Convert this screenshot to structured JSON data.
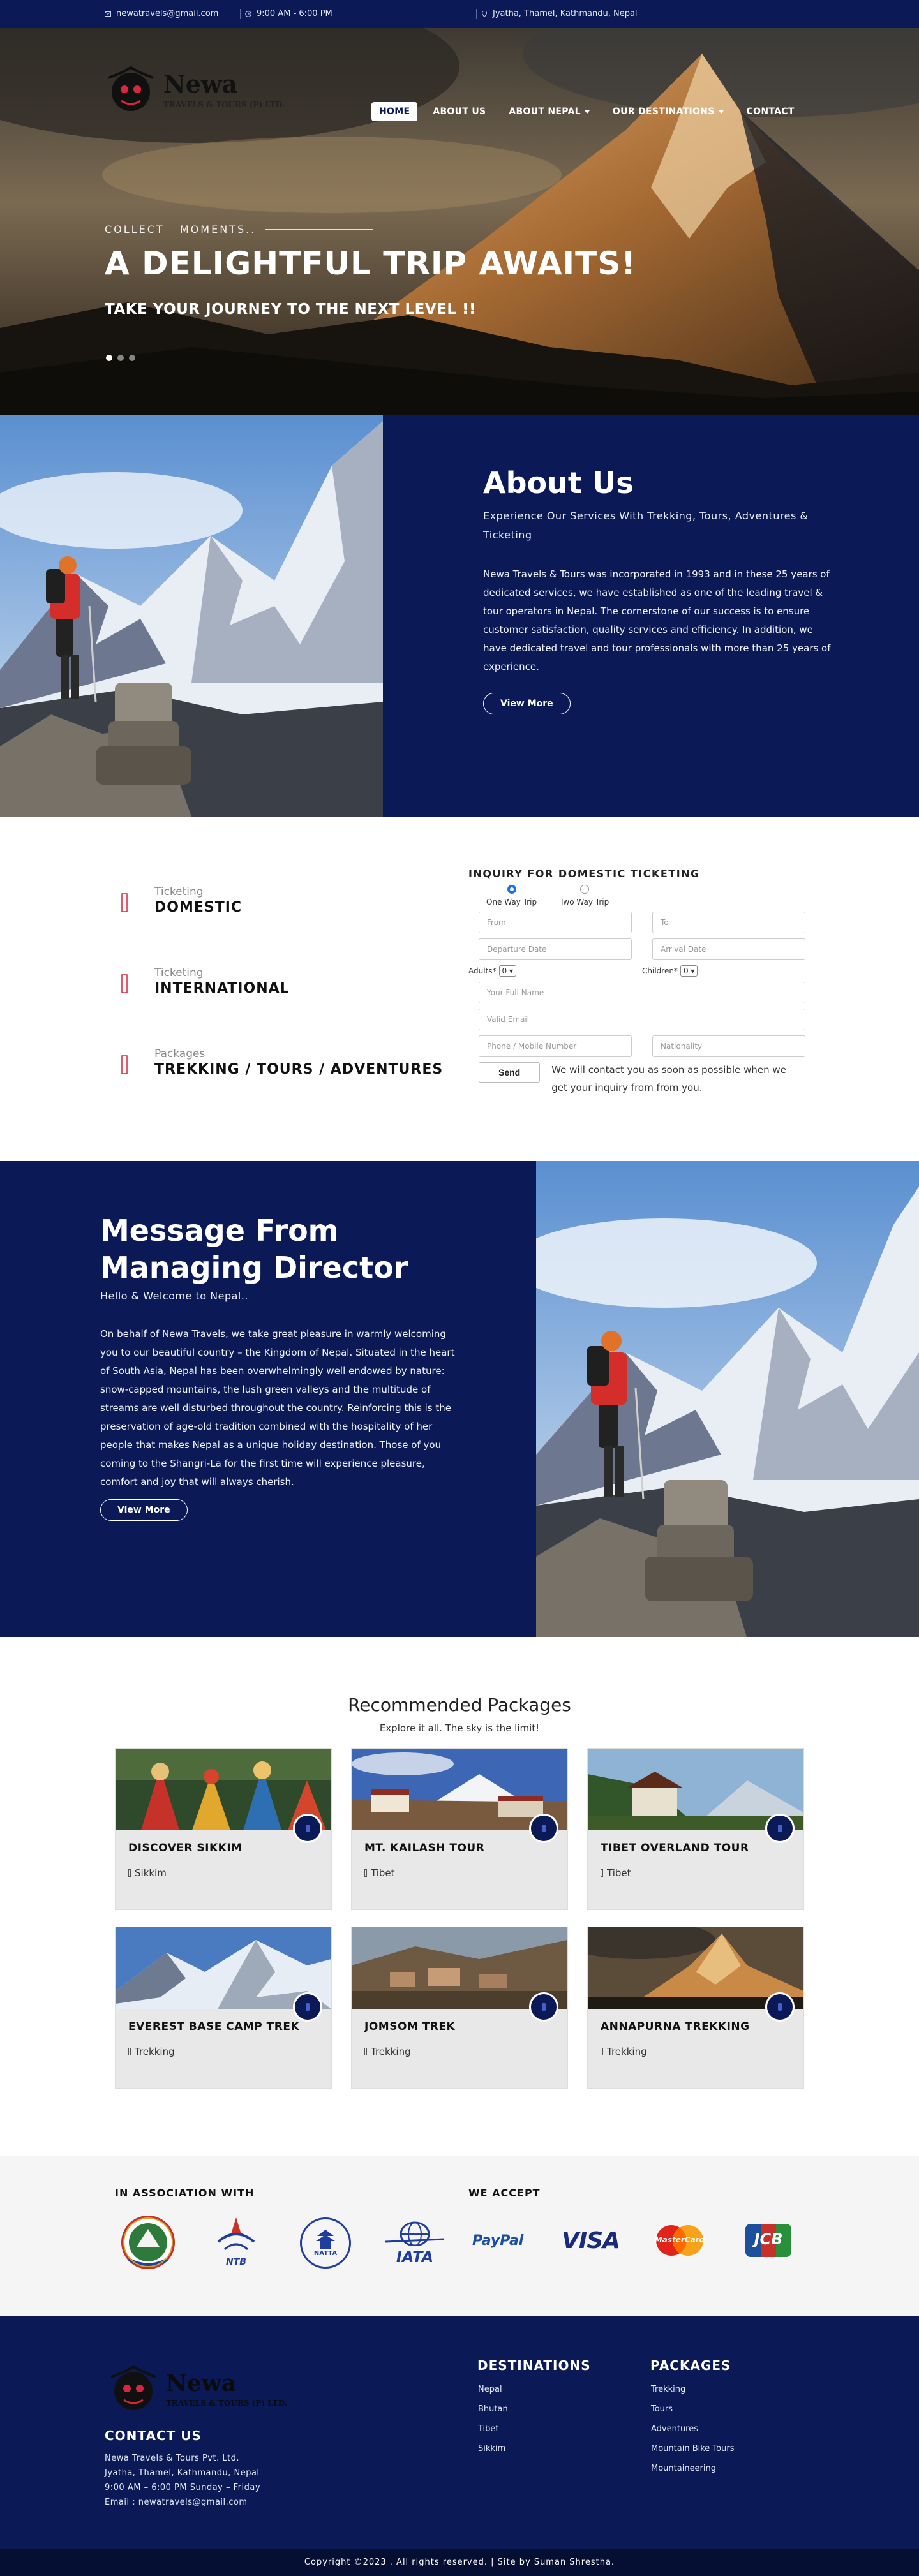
{
  "topbar": {
    "email": "newatravels@gmail.com",
    "hours": "9:00 AM - 6:00 PM",
    "address": "Jyatha, Thamel, Kathmandu, Nepal"
  },
  "brand": {
    "name": "Newa",
    "subtitle": "TRAVELS & TOURS (P) LTD."
  },
  "nav": {
    "items": [
      {
        "label": "HOME",
        "active": true
      },
      {
        "label": "ABOUT US"
      },
      {
        "label": "ABOUT NEPAL",
        "dropdown": true
      },
      {
        "label": "OUR DESTINATIONS",
        "dropdown": true
      },
      {
        "label": "CONTACT"
      }
    ]
  },
  "hero": {
    "kicker": "COLLECT   MOMENTS..",
    "headline": "A DELIGHTFUL TRIP AWAITS!",
    "subheadline": "TAKE YOUR JOURNEY TO THE NEXT LEVEL !!"
  },
  "about": {
    "title": "About Us",
    "subtitle": "Experience Our Services With Trekking, Tours, Adventures & Ticketing",
    "body": "Newa Travels & Tours was incorporated in 1993 and in these 25 years of dedicated services, we have established as one of the leading travel & tour operators in Nepal. The cornerstone of our success is to ensure customer satisfaction, quality services and efficiency. In addition, we have dedicated travel and tour professionals with more than 25 years of experience.",
    "button": "View More"
  },
  "services": [
    {
      "label": "Ticketing",
      "value": "DOMESTIC"
    },
    {
      "label": "Ticketing",
      "value": "INTERNATIONAL"
    },
    {
      "label": "Packages",
      "value": "TREKKING / TOURS / ADVENTURES"
    }
  ],
  "inquiry": {
    "title": "INQUIRY FOR DOMESTIC TICKETING",
    "one_way": "One Way Trip",
    "two_way": "Two Way Trip",
    "from_placeholder": "From",
    "to_placeholder": "To",
    "departure_placeholder": "Departure Date",
    "arrival_placeholder": "Arrival Date",
    "adults_label": "Adults*",
    "adults_value": "0",
    "children_label": "Children*",
    "children_value": "0",
    "name_placeholder": "Your Full Name",
    "email_placeholder": "Valid Email",
    "phone_placeholder": "Phone / Mobile Number",
    "nationality_placeholder": "Nationality",
    "send_label": "Send",
    "note": "We will contact you as soon as possible when we get your inquiry from from you."
  },
  "message": {
    "title": "Message From Managing Director",
    "subtitle": "Hello & Welcome to Nepal..",
    "body": "On behalf of Newa Travels, we take great pleasure in warmly welcoming you to our beautiful country – the Kingdom of Nepal. Situated in the heart of South Asia, Nepal has been overwhelmingly well endowed by nature: snow-capped mountains, the lush green valleys and the multitude of streams are well disturbed throughout the country. Reinforcing this is the preservation of age-old tradition combined with the hospitality of her people that makes Nepal as a unique holiday destination. Those of you coming to the Shangri-La for the first time will experience pleasure, comfort and joy that will always cherish.",
    "button": "View More"
  },
  "packages": {
    "title": "Recommended Packages",
    "tagline": "Explore it all. The sky is the limit!",
    "items": [
      {
        "title": "DISCOVER SIKKIM",
        "category": "Sikkim"
      },
      {
        "title": "MT. KAILASH TOUR",
        "category": "Tibet"
      },
      {
        "title": "TIBET OVERLAND TOUR",
        "category": "Tibet"
      },
      {
        "title": "EVEREST BASE CAMP TREK",
        "category": "Trekking"
      },
      {
        "title": "JOMSOM TREK",
        "category": "Trekking"
      },
      {
        "title": "ANNAPURNA TREKKING",
        "category": "Trekking"
      }
    ]
  },
  "association": {
    "title": "IN ASSOCIATION WITH",
    "logos": [
      "Nepal Government emblem",
      "NTB",
      "NATTA",
      "IATA"
    ],
    "ntb_text": "NTB",
    "natta_text": "NATTA",
    "iata_text": "IATA"
  },
  "payments": {
    "title": "WE ACCEPT",
    "paypal": "PayPal",
    "visa": "VISA",
    "mastercard": "MasterCard",
    "jcb": "JCB"
  },
  "footer": {
    "contact_title": "CONTACT US",
    "contact_lines": [
      "Newa Travels & Tours Pvt. Ltd.",
      "Jyatha, Thamel, Kathmandu, Nepal",
      "9:00 AM – 6:00 PM Sunday – Friday",
      "Email : newatravels@gmail.com"
    ],
    "destinations_title": "DESTINATIONS",
    "destinations": [
      "Nepal",
      "Bhutan",
      "Tibet",
      "Sikkim"
    ],
    "packages_title": "PACKAGES",
    "packages": [
      "Trekking",
      "Tours",
      "Adventures",
      "Mountain Bike Tours",
      "Mountaineering"
    ],
    "copyright": "Copyright ©2023 . All rights reserved. | Site by Suman Shrestha."
  },
  "colors": {
    "navy": "#0b1a56",
    "accent_red": "#d9253d",
    "white": "#ffffff"
  },
  "icons": [
    "envelope-icon",
    "clock-icon",
    "location-icon",
    "ticket-icon",
    "map-pin-icon"
  ]
}
